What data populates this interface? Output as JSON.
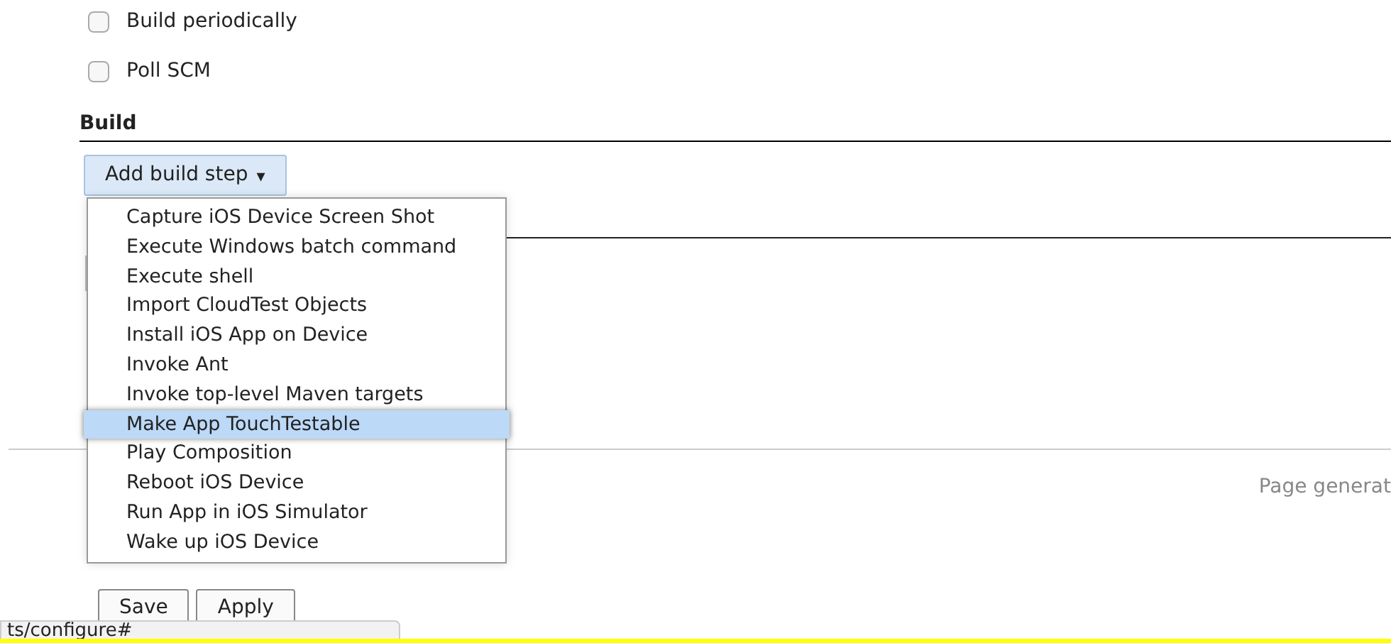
{
  "triggers": [
    {
      "label": "Build periodically",
      "checked": false
    },
    {
      "label": "Poll SCM",
      "checked": false
    }
  ],
  "build_section": {
    "heading": "Build",
    "add_button": "Add build step",
    "caret": "▾"
  },
  "build_step_menu": [
    {
      "label": "Capture iOS Device Screen Shot",
      "selected": false
    },
    {
      "label": "Execute Windows batch command",
      "selected": false
    },
    {
      "label": "Execute shell",
      "selected": false
    },
    {
      "label": "Import CloudTest Objects",
      "selected": false
    },
    {
      "label": "Install iOS App on Device",
      "selected": false
    },
    {
      "label": "Invoke Ant",
      "selected": false
    },
    {
      "label": "Invoke top-level Maven targets",
      "selected": false
    },
    {
      "label": "Make App TouchTestable",
      "selected": true
    },
    {
      "label": "Play Composition",
      "selected": false
    },
    {
      "label": "Reboot iOS Device",
      "selected": false
    },
    {
      "label": "Run App in iOS Simulator",
      "selected": false
    },
    {
      "label": "Wake up iOS Device",
      "selected": false
    }
  ],
  "footer": {
    "text": "Page generat"
  },
  "buttons": [
    "Save",
    "Apply"
  ],
  "status_bar": {
    "url": "ts/configure#"
  }
}
